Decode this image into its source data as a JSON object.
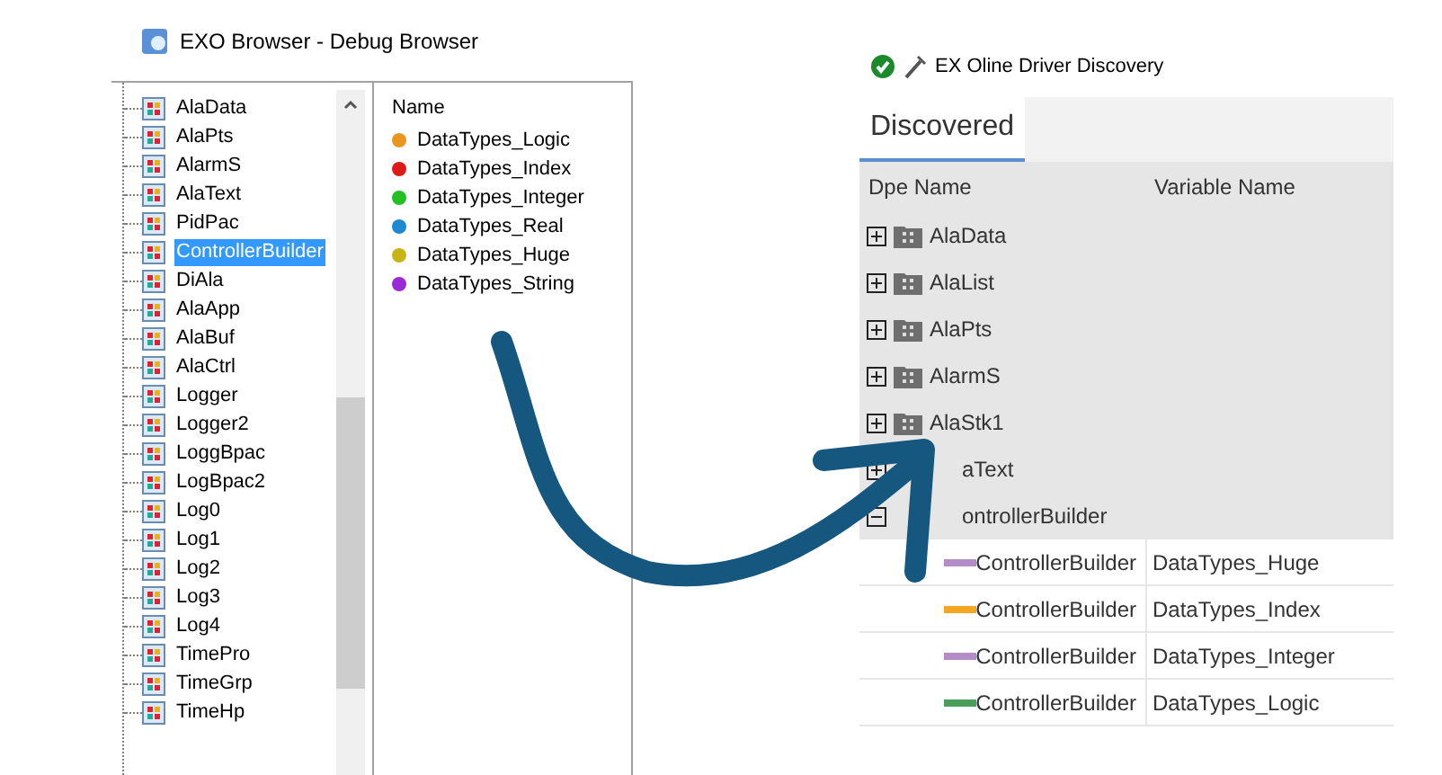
{
  "left_window": {
    "title": "EXO Browser - Debug Browser",
    "tree": [
      {
        "label": "AlaData",
        "selected": false
      },
      {
        "label": "AlaPts",
        "selected": false
      },
      {
        "label": "AlarmS",
        "selected": false
      },
      {
        "label": "AlaText",
        "selected": false
      },
      {
        "label": "PidPac",
        "selected": false
      },
      {
        "label": "ControllerBuilder",
        "selected": true
      },
      {
        "label": "DiAla",
        "selected": false
      },
      {
        "label": "AlaApp",
        "selected": false
      },
      {
        "label": "AlaBuf",
        "selected": false
      },
      {
        "label": "AlaCtrl",
        "selected": false
      },
      {
        "label": "Logger",
        "selected": false
      },
      {
        "label": "Logger2",
        "selected": false
      },
      {
        "label": "LoggBpac",
        "selected": false
      },
      {
        "label": "LogBpac2",
        "selected": false
      },
      {
        "label": "Log0",
        "selected": false
      },
      {
        "label": "Log1",
        "selected": false
      },
      {
        "label": "Log2",
        "selected": false
      },
      {
        "label": "Log3",
        "selected": false
      },
      {
        "label": "Log4",
        "selected": false
      },
      {
        "label": "TimePro",
        "selected": false
      },
      {
        "label": "TimeGrp",
        "selected": false
      },
      {
        "label": "TimeHp",
        "selected": false
      }
    ],
    "list_header": "Name",
    "list": [
      {
        "label": "DataTypes_Logic",
        "color": "#e8961e"
      },
      {
        "label": "DataTypes_Index",
        "color": "#dd1a1a"
      },
      {
        "label": "DataTypes_Integer",
        "color": "#22c022"
      },
      {
        "label": "DataTypes_Real",
        "color": "#1e88d0"
      },
      {
        "label": "DataTypes_Huge",
        "color": "#c8b414"
      },
      {
        "label": "DataTypes_String",
        "color": "#9a2ad6"
      }
    ]
  },
  "right_window": {
    "title": "EX Oline Driver Discovery",
    "tab": "Discovered",
    "columns": [
      "Dpe Name",
      "Variable Name"
    ],
    "groups": [
      {
        "label": "AlaData",
        "expanded": false
      },
      {
        "label": "AlaList",
        "expanded": false
      },
      {
        "label": "AlaPts",
        "expanded": false
      },
      {
        "label": "AlarmS",
        "expanded": false
      },
      {
        "label": "AlaStk1",
        "expanded": false
      },
      {
        "label": "aText",
        "expanded": false
      },
      {
        "label": "ontrollerBuilder",
        "expanded": true
      }
    ],
    "rows": [
      {
        "dpe": "ControllerBuilder",
        "variable": "DataTypes_Huge",
        "color": "#b48cc8"
      },
      {
        "dpe": "ControllerBuilder",
        "variable": "DataTypes_Index",
        "color": "#f5a623"
      },
      {
        "dpe": "ControllerBuilder",
        "variable": "DataTypes_Integer",
        "color": "#b48cc8"
      },
      {
        "dpe": "ControllerBuilder",
        "variable": "DataTypes_Logic",
        "color": "#4a9e5a"
      }
    ]
  }
}
